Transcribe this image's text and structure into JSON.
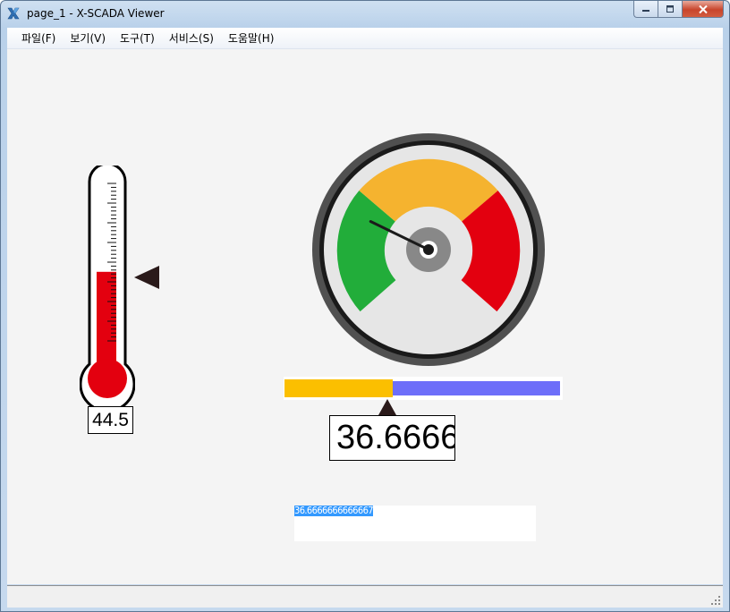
{
  "window": {
    "title": "page_1 - X-SCADA Viewer",
    "icon": "x-scada-app-icon"
  },
  "menu": {
    "items": [
      {
        "label": "파일(F)"
      },
      {
        "label": "보기(V)"
      },
      {
        "label": "도구(T)"
      },
      {
        "label": "서비스(S)"
      },
      {
        "label": "도움말(H)"
      }
    ]
  },
  "thermometer": {
    "value": "44.5",
    "fill_fraction": 0.52,
    "fill_color": "#e3000f"
  },
  "gauge": {
    "needle_fraction": 0.28,
    "zones": [
      {
        "name": "green",
        "color": "#22ad3a"
      },
      {
        "name": "yellow",
        "color": "#f5b32f"
      },
      {
        "name": "red",
        "color": "#e3000f"
      }
    ]
  },
  "progress_bar": {
    "value": "36.6666",
    "fill_percent": 36.67,
    "fill_color": "#fbbf00",
    "track_color": "#6d6ef9"
  },
  "text_field": {
    "value": "36.6666666666667"
  }
}
